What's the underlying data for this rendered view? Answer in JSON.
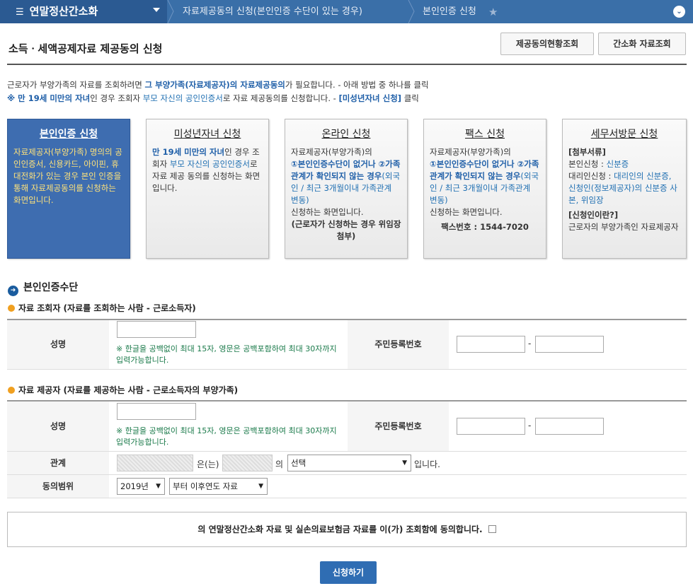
{
  "topbar": {
    "title": "연말정산간소화",
    "crumb1": "자료제공동의 신청(본인인증 수단이 있는 경우)",
    "crumb2": "본인인증 신청"
  },
  "header": {
    "page_title": "소득ㆍ세액공제자료 제공동의 신청",
    "btn_status": "제공동의현황조회",
    "btn_simple": "간소화 자료조회"
  },
  "intro": {
    "line1_a": "근로자가 부양가족의 자료를 조회하려면 ",
    "line1_b": "그 부양가족(자료제공자)의 자료제공동의",
    "line1_c": "가 필요합니다. - 아래 방법 중 하나를 클릭",
    "line2_a": "※ 만 19세 미만의 자녀",
    "line2_b": "인 경우 조회자 ",
    "line2_c": "부모 자신의 공인인증서",
    "line2_d": "로 자료 제공동의를 신청합니다. - ",
    "line2_e": "[미성년자녀 신청]",
    "line2_f": " 클릭"
  },
  "cards": [
    {
      "title": "본인인증 신청",
      "body": "자료제공자(부양가족) 명의의 공인인증서, 신용카드, 아이핀, 휴대전화가 있는 경우 본인 인증을 통해 자료제공동의를 신청하는 화면입니다."
    },
    {
      "title": "미성년자녀 신청",
      "b1": "만 19세 미만의 자녀",
      "b2": "인 경우 조회자 ",
      "b3": "부모 자신의 공인인증서",
      "b4": "로 자료 제공 동의를 신청하는 화면입니다."
    },
    {
      "title": "온라인 신청",
      "b1": "자료제공자(부양가족)의",
      "b2": "①본인인증수단이 없거나 ②가족관계가 확인되지 않는 경우",
      "b3": "(외국인 / 최근 3개월이내 가족관계 변동)",
      "b4": "신청하는 화면입니다.",
      "b5": "(근로자가 신청하는 경우 위임장 첨부)"
    },
    {
      "title": "팩스 신청",
      "b1": "자료제공자(부양가족)의",
      "b2": "①본인인증수단이 없거나 ②가족관계가 확인되지 않는 경우",
      "b3": "(외국인 / 최근 3개월이내 가족관계 변동)",
      "b4": "신청하는 화면입니다.",
      "b5": "팩스번호 : 1544-7020"
    },
    {
      "title": "세무서방문 신청",
      "b1": "[첨부서류]",
      "b2": "본인신청 : ",
      "b3": "신분증",
      "b4": "대리인신청 : ",
      "b5": "대리인의 신분증, 신청인(정보제공자)의 신분증 사본, 위임장",
      "b6": "[신청인이란?]",
      "b7": "근로자의 부양가족인 자료제공자"
    }
  ],
  "section": {
    "title": "본인인증수단",
    "viewer_title": "자료 조회자 (자료를 조회하는 사람 - 근로소득자)",
    "provider_title": "자료 제공자 (자료를 제공하는 사람 - 근로소득자의 부양가족)"
  },
  "form": {
    "name_label": "성명",
    "rrn_label": "주민등록번호",
    "name_note": "※ 한글을 공백없이 최대 15자, 영문은 공백포함하여 최대 30자까지 입력가능합니다.",
    "dash": "-",
    "relation_label": "관계",
    "relation_text1": "은(는)",
    "relation_text2": "의",
    "relation_select": "선택",
    "relation_end": "입니다.",
    "scope_label": "동의범위",
    "scope_year": "2019년",
    "scope_range": "부터 이후연도 자료"
  },
  "agree": {
    "text": "의 연말정산간소화 자료 및 실손의료보험금 자료를 이(가) 조회함에 동의합니다."
  },
  "submit": {
    "label": "신청하기"
  }
}
